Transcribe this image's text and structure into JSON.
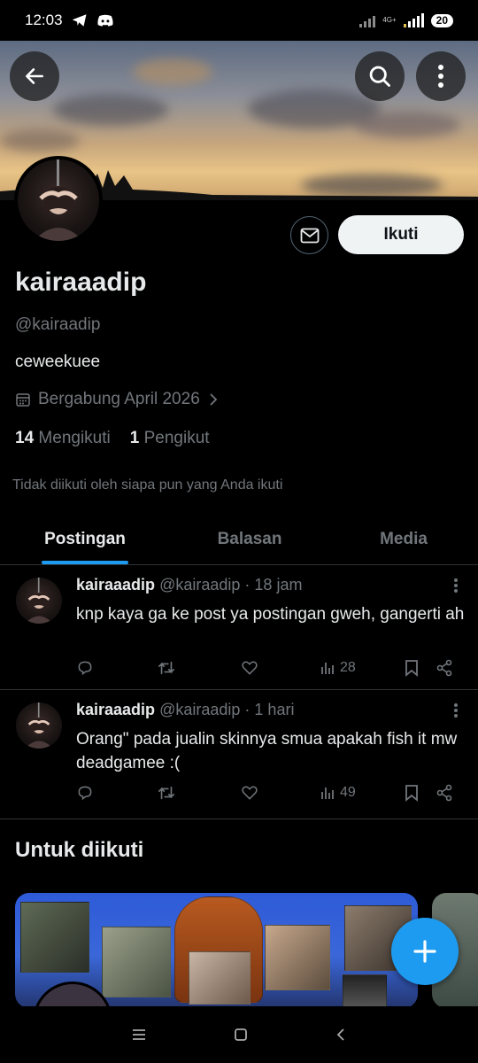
{
  "status_bar": {
    "time": "12:03",
    "network": "4G+",
    "battery": "20"
  },
  "profile": {
    "name": "kairaaadip",
    "handle": "@kairaadip",
    "bio": "ceweekuee",
    "joined": "Bergabung April 2026",
    "following_count": "14",
    "following_label": "Mengikuti",
    "followers_count": "1",
    "followers_label": "Pengikut",
    "not_followed_note": "Tidak diikuti oleh siapa pun yang Anda ikuti",
    "follow_label": "Ikuti"
  },
  "tabs": [
    {
      "label": "Postingan",
      "active": true
    },
    {
      "label": "Balasan",
      "active": false
    },
    {
      "label": "Media",
      "active": false
    }
  ],
  "posts": [
    {
      "name": "kairaaadip",
      "handle": "@kairaadip",
      "time": "· 18 jam",
      "text": "knp kaya ga ke post ya postingan gweh, gangerti ah",
      "views": "28"
    },
    {
      "name": "kairaaadip",
      "handle": "@kairaadip",
      "time": "· 1 hari",
      "text": "Orang\" pada jualin skinnya smua apakah fish it mw deadgamee :(",
      "views": "49"
    }
  ],
  "suggestions": {
    "title": "Untuk diikuti"
  },
  "colors": {
    "accent": "#1d9bf0",
    "background": "#000000",
    "muted_text": "#71767b",
    "divider": "#2f3336"
  }
}
